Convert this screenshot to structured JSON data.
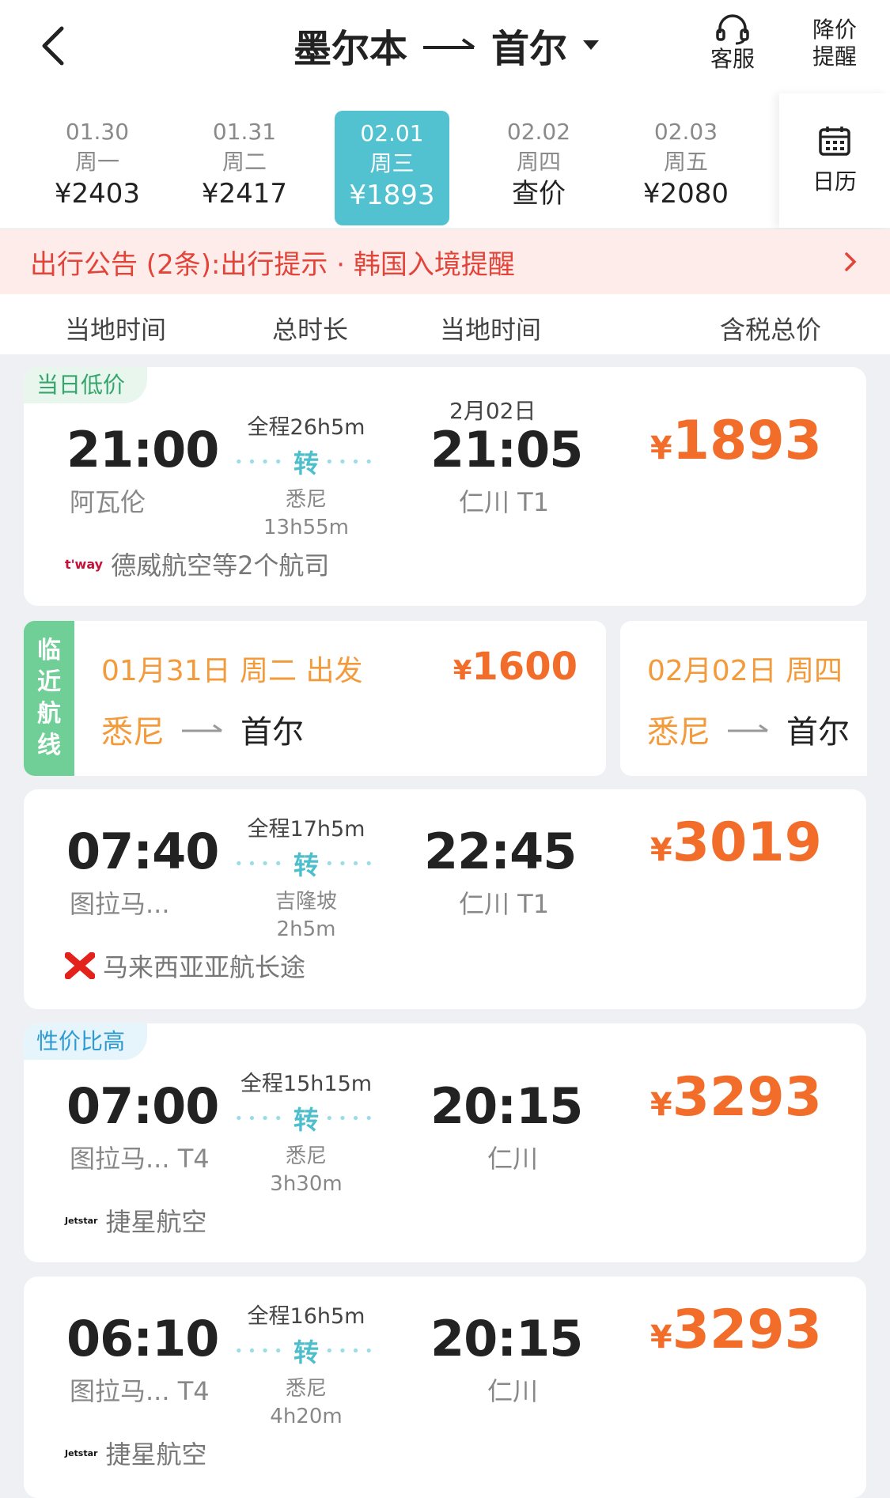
{
  "header": {
    "origin": "墨尔本",
    "destination": "首尔",
    "service_label": "客服",
    "price_alert_line1": "降价",
    "price_alert_line2": "提醒"
  },
  "dates": [
    {
      "date": "01.30",
      "weekday": "周一",
      "price": "¥2403",
      "active": false
    },
    {
      "date": "01.31",
      "weekday": "周二",
      "price": "¥2417",
      "active": false
    },
    {
      "date": "02.01",
      "weekday": "周三",
      "price": "¥1893",
      "active": true
    },
    {
      "date": "02.02",
      "weekday": "周四",
      "price": "查价",
      "active": false
    },
    {
      "date": "02.03",
      "weekday": "周五",
      "price": "¥2080",
      "active": false
    }
  ],
  "calendar_label": "日历",
  "notice": "出行公告 (2条):出行提示 · 韩国入境提醒",
  "sortbar": {
    "dep_time": "当地时间",
    "duration": "总时长",
    "arr_time": "当地时间",
    "price": "含税总价"
  },
  "flights": [
    {
      "tag": "当日低价",
      "dep_time": "21:00",
      "dep_airport": "阿瓦伦",
      "total": "全程26h5m",
      "transfer": "转",
      "via": "悉尼",
      "layover": "13h55m",
      "arr_date": "2月02日",
      "arr_time": "21:05",
      "arr_airport": "仁川 T1",
      "currency": "¥",
      "price": "1893",
      "airline_logo": "t'way",
      "airline": "德威航空等2个航司"
    },
    {
      "tag": "",
      "dep_time": "07:40",
      "dep_airport": "图拉马...",
      "total": "全程17h5m",
      "transfer": "转",
      "via": "吉隆坡",
      "layover": "2h5m",
      "arr_date": "",
      "arr_time": "22:45",
      "arr_airport": "仁川 T1",
      "currency": "¥",
      "price": "3019",
      "airline_logo": "airasia-x",
      "airline": "马来西亚亚航长途"
    },
    {
      "tag": "性价比高",
      "dep_time": "07:00",
      "dep_airport": "图拉马... T4",
      "total": "全程15h15m",
      "transfer": "转",
      "via": "悉尼",
      "layover": "3h30m",
      "arr_date": "",
      "arr_time": "20:15",
      "arr_airport": "仁川",
      "currency": "¥",
      "price": "3293",
      "airline_logo": "Jetstar",
      "airline": "捷星航空"
    },
    {
      "tag": "",
      "dep_time": "06:10",
      "dep_airport": "图拉马... T4",
      "total": "全程16h5m",
      "transfer": "转",
      "via": "悉尼",
      "layover": "4h20m",
      "arr_date": "",
      "arr_time": "20:15",
      "arr_airport": "仁川",
      "currency": "¥",
      "price": "3293",
      "airline_logo": "Jetstar",
      "airline": "捷星航空"
    }
  ],
  "nearby": {
    "label_chars": [
      "临",
      "近",
      "航",
      "线"
    ],
    "routes": [
      {
        "date": "01月31日  周二  出发",
        "currency": "¥",
        "price": "1600",
        "from": "悉尼",
        "to": "首尔"
      },
      {
        "date": "02月02日  周四",
        "currency": "",
        "price": "",
        "from": "悉尼",
        "to": "首尔"
      }
    ]
  }
}
